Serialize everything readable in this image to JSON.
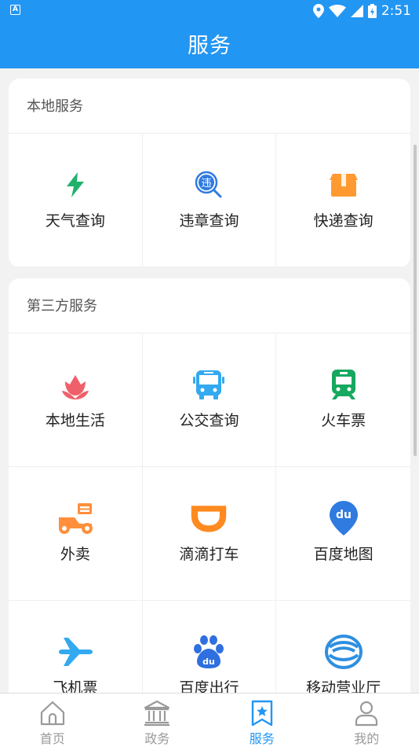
{
  "status_bar": {
    "notification_badge": "A",
    "time": "2:51"
  },
  "app_bar": {
    "title": "服务"
  },
  "local_services": {
    "title": "本地服务",
    "items": [
      {
        "label": "天气查询",
        "icon": "lightning-icon",
        "color": "#1fb26b"
      },
      {
        "label": "违章查询",
        "icon": "violation-search-icon",
        "color": "#2f7be0",
        "glyph": "违"
      },
      {
        "label": "快递查询",
        "icon": "package-box-icon",
        "color": "#ff9a33"
      }
    ]
  },
  "third_party_services": {
    "title": "第三方服务",
    "items": [
      {
        "label": "本地生活",
        "icon": "tulip-icon",
        "color": "#f0606a"
      },
      {
        "label": "公交查询",
        "icon": "bus-icon",
        "color": "#33a9f0"
      },
      {
        "label": "火车票",
        "icon": "train-icon",
        "color": "#17a85f"
      },
      {
        "label": "外卖",
        "icon": "delivery-scooter-icon",
        "color": "#ff8f3a"
      },
      {
        "label": "滴滴打车",
        "icon": "didi-icon",
        "color": "#ff8a1f"
      },
      {
        "label": "百度地图",
        "icon": "map-pin-icon",
        "color": "#2f7be0",
        "glyph": "du"
      },
      {
        "label": "飞机票",
        "icon": "airplane-icon",
        "color": "#33a9f0"
      },
      {
        "label": "百度出行",
        "icon": "baidu-paw-icon",
        "color": "#2f6fe0",
        "glyph": "du"
      },
      {
        "label": "移动营业厅",
        "icon": "china-mobile-icon",
        "color": "#2f8fe0"
      }
    ]
  },
  "bottom_nav": {
    "items": [
      {
        "label": "首页",
        "icon": "home-icon",
        "active": false
      },
      {
        "label": "政务",
        "icon": "government-building-icon",
        "active": false
      },
      {
        "label": "服务",
        "icon": "star-bookmark-icon",
        "active": true
      },
      {
        "label": "我的",
        "icon": "person-icon",
        "active": false
      }
    ]
  },
  "colors": {
    "primary": "#2296f3",
    "inactive": "#9a9a9a",
    "background": "#f2f2f2"
  }
}
